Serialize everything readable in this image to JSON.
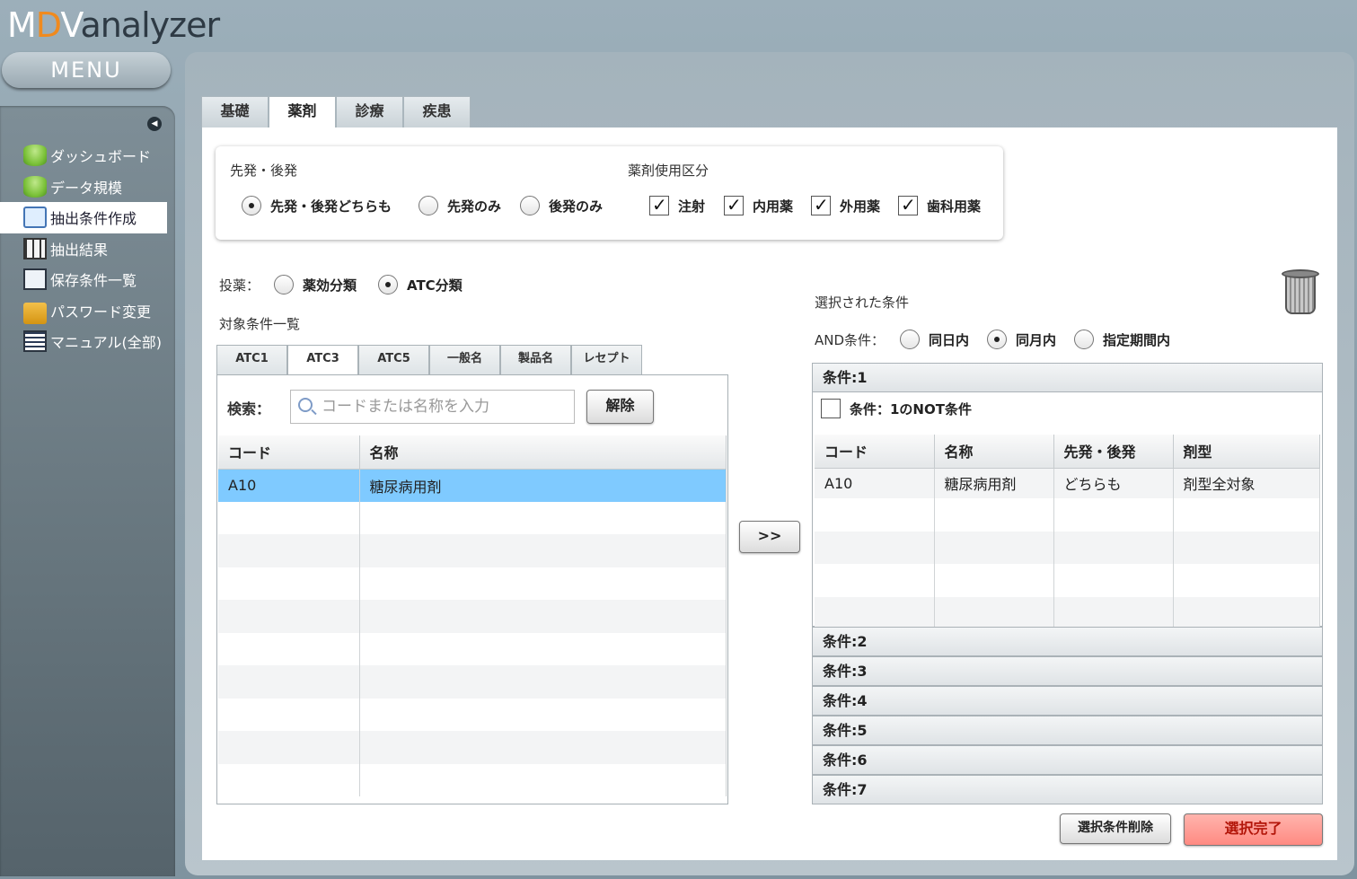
{
  "logo": {
    "p1": "M",
    "p2": "D",
    "p3": "V",
    "p4": "analyzer"
  },
  "menu_label": "MENU",
  "sidebar": {
    "items": [
      {
        "label": "ダッシュボード",
        "icon": "database-icon"
      },
      {
        "label": "データ規模",
        "icon": "database-icon"
      },
      {
        "label": "抽出条件作成",
        "icon": "search-document-icon",
        "active": true
      },
      {
        "label": "抽出結果",
        "icon": "table-icon"
      },
      {
        "label": "保存条件一覧",
        "icon": "list-icon"
      },
      {
        "label": "パスワード変更",
        "icon": "lock-icon"
      },
      {
        "label": "マニュアル(全部)",
        "icon": "document-icon"
      }
    ]
  },
  "main_tabs": [
    "基礎",
    "薬剤",
    "診療",
    "疾患"
  ],
  "active_main_tab": "薬剤",
  "generic": {
    "label": "先発・後発",
    "options": [
      "先発・後発どちらも",
      "先発のみ",
      "後発のみ"
    ],
    "selected": "先発・後発どちらも"
  },
  "usage": {
    "label": "薬剤使用区分",
    "options": [
      "注射",
      "内用薬",
      "外用薬",
      "歯科用薬"
    ],
    "checked": [
      true,
      true,
      true,
      true
    ]
  },
  "dosing": {
    "label": "投薬：",
    "options": [
      "薬効分類",
      "ATC分類"
    ],
    "selected": "ATC分類"
  },
  "target_list_label": "対象条件一覧",
  "sub_tabs": [
    "ATC1",
    "ATC3",
    "ATC5",
    "一般名",
    "製品名",
    "レセプト"
  ],
  "active_sub_tab": "ATC3",
  "search": {
    "label": "検索：",
    "placeholder": "コードまたは名称を入力",
    "clear_label": "解除"
  },
  "left_table": {
    "headers": [
      "コード",
      "名称"
    ],
    "rows": [
      {
        "code": "A10",
        "name": "糖尿病用剤"
      }
    ]
  },
  "move_button": ">>",
  "selected_conditions": {
    "label": "選択された条件",
    "and_label": "AND条件：",
    "and_options": [
      "同日内",
      "同月内",
      "指定期間内"
    ],
    "and_selected": "同月内",
    "conditions": [
      "条件:1",
      "条件:2",
      "条件:3",
      "条件:4",
      "条件:5",
      "条件:6",
      "条件:7"
    ],
    "not_label": "条件：1のNOT条件",
    "table": {
      "headers": [
        "コード",
        "名称",
        "先発・後発",
        "剤型"
      ],
      "rows": [
        {
          "code": "A10",
          "name": "糖尿病用剤",
          "generic": "どちらも",
          "form": "剤型全対象"
        }
      ]
    }
  },
  "delete_selection_label": "選択条件削除",
  "done_label": "選択完了",
  "colors": {
    "accent": "#f08a1e",
    "selected_row": "#7fcaff",
    "done_button": "#ff8f88"
  }
}
